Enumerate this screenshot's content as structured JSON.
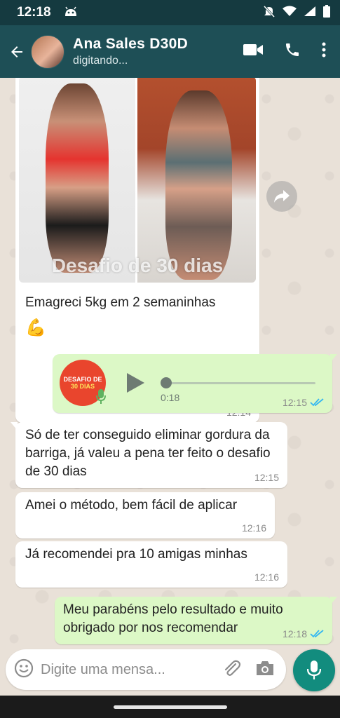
{
  "statusbar": {
    "time": "12:18"
  },
  "header": {
    "contact_name": "Ana Sales D30D",
    "status": "digitando..."
  },
  "messages": {
    "image": {
      "watermark": "Desafio de 30 dias",
      "caption": "Emagreci 5kg em 2 semaninhas",
      "emoji": "💪",
      "time": "12:14"
    },
    "voice": {
      "thumb_line1": "DESAFIO DE",
      "thumb_line2": "30 DIAS",
      "duration": "0:18",
      "time": "12:15"
    },
    "m1": {
      "text": "Só de ter conseguido eliminar gordura da barriga, já valeu a pena ter feito o desafio de 30 dias",
      "time": "12:15"
    },
    "m2": {
      "text": "Amei o método, bem fácil de aplicar",
      "time": "12:16"
    },
    "m3": {
      "text": "Já recomendei pra 10 amigas minhas",
      "time": "12:16"
    },
    "m4": {
      "text": "Meu parabéns pelo resultado e muito obrigado por nos recomendar",
      "time": "12:18"
    }
  },
  "input": {
    "placeholder": "Digite uma mensa..."
  },
  "colors": {
    "header": "#1e4f56",
    "outgoing": "#dcf8c6",
    "accent": "#128c7e",
    "read_ticks": "#34b7f1"
  }
}
